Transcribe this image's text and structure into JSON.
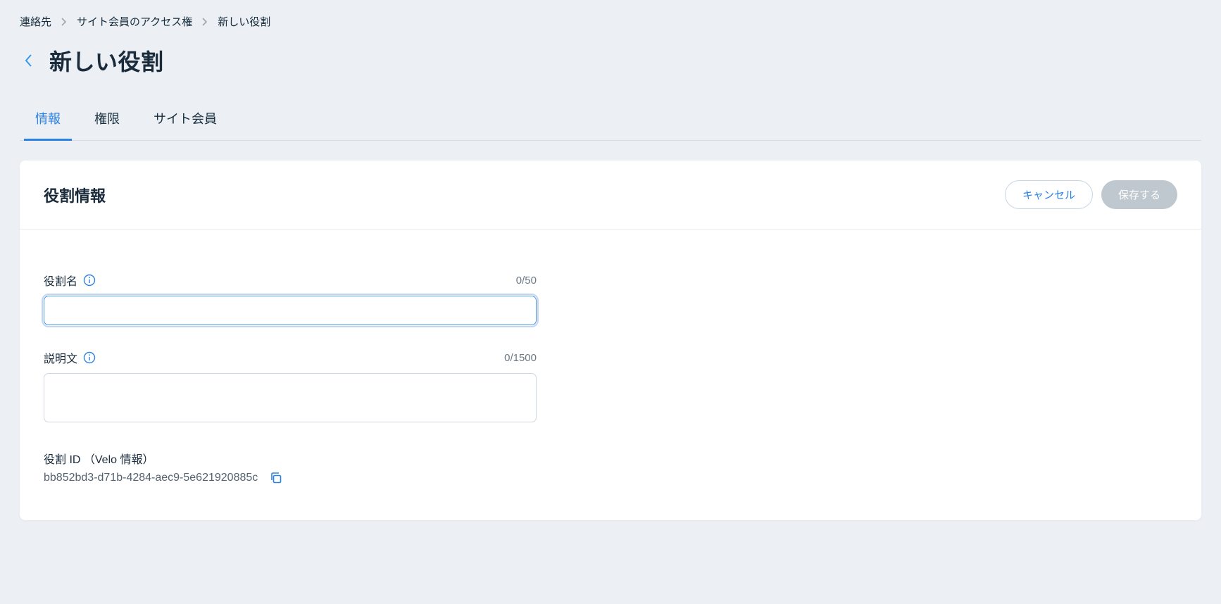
{
  "breadcrumb": {
    "items": [
      "連絡先",
      "サイト会員のアクセス権",
      "新しい役割"
    ]
  },
  "header": {
    "title": "新しい役割"
  },
  "tabs": {
    "items": [
      {
        "label": "情報",
        "active": true
      },
      {
        "label": "権限",
        "active": false
      },
      {
        "label": "サイト会員",
        "active": false
      }
    ]
  },
  "card": {
    "sectionTitle": "役割情報",
    "buttons": {
      "cancel": "キャンセル",
      "save": "保存する"
    },
    "fields": {
      "roleName": {
        "label": "役割名",
        "counter": "0/50",
        "value": ""
      },
      "description": {
        "label": "説明文",
        "counter": "0/1500",
        "value": ""
      },
      "roleId": {
        "label": "役割 ID （Velo 情報）",
        "value": "bb852bd3-d71b-4284-aec9-5e621920885c"
      }
    }
  }
}
